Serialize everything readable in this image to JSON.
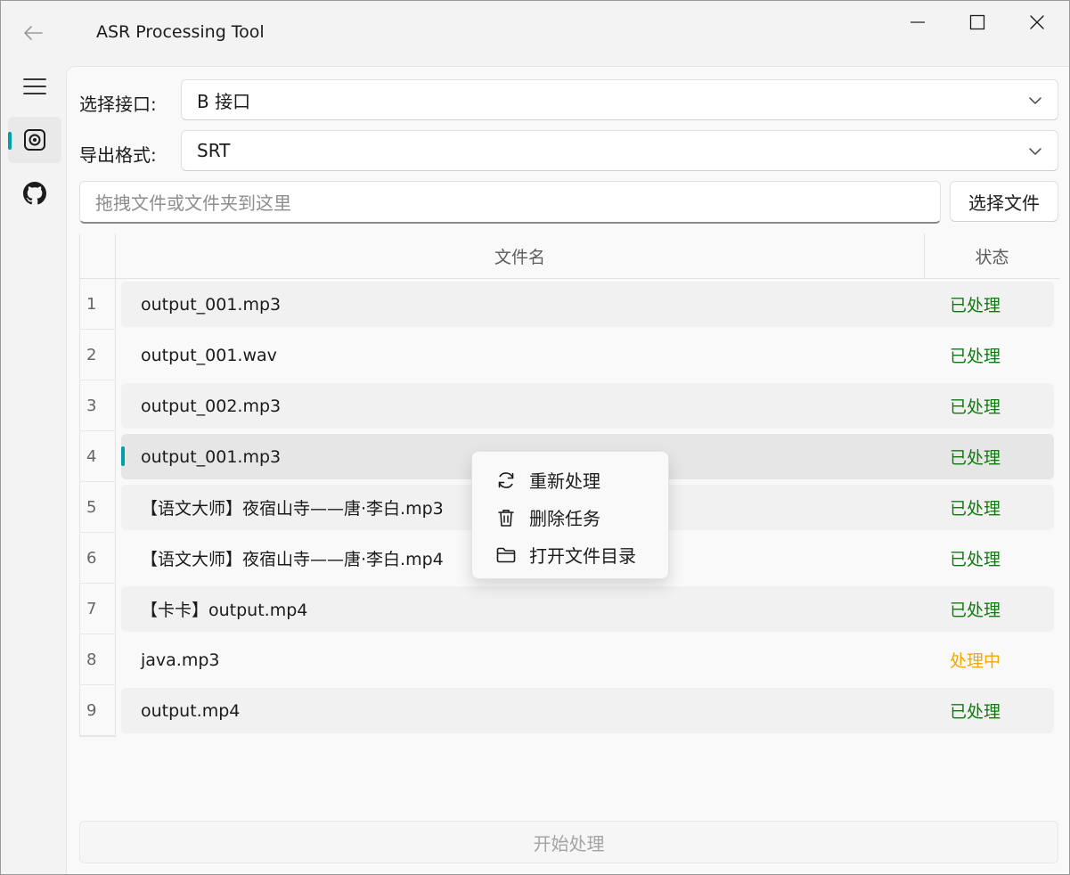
{
  "window": {
    "title": "ASR Processing Tool",
    "accent_color": "#009faa"
  },
  "nav": {
    "items": [
      {
        "icon": "hamburger-menu-icon"
      },
      {
        "icon": "asr-record-icon",
        "selected": true
      },
      {
        "icon": "github-icon"
      }
    ]
  },
  "form": {
    "api_label": "选择接口:",
    "api_value": "B 接口",
    "format_label": "导出格式:",
    "format_value": "SRT",
    "drop_placeholder": "拖拽文件或文件夹到这里",
    "select_file_label": "选择文件"
  },
  "table": {
    "headers": {
      "name": "文件名",
      "status": "状态"
    },
    "rows": [
      {
        "num": "1",
        "name": "output_001.mp3",
        "status": "已处理"
      },
      {
        "num": "2",
        "name": "output_001.wav",
        "status": "已处理"
      },
      {
        "num": "3",
        "name": "output_002.mp3",
        "status": "已处理"
      },
      {
        "num": "4",
        "name": "output_001.mp3",
        "status": "已处理"
      },
      {
        "num": "5",
        "name": "【语文大师】夜宿山寺——唐·李白.mp3",
        "status": "已处理"
      },
      {
        "num": "6",
        "name": "【语文大师】夜宿山寺——唐·李白.mp4",
        "status": "已处理"
      },
      {
        "num": "7",
        "name": "【卡卡】output.mp4",
        "status": "已处理"
      },
      {
        "num": "8",
        "name": "java.mp3",
        "status": "处理中"
      },
      {
        "num": "9",
        "name": "output.mp4",
        "status": "已处理"
      }
    ],
    "status_colors": {
      "done": "#0f7b0f",
      "processing": "#f2a900"
    }
  },
  "context_menu": {
    "items": [
      {
        "icon": "refresh-icon",
        "label": "重新处理"
      },
      {
        "icon": "trash-icon",
        "label": "删除任务"
      },
      {
        "icon": "folder-icon",
        "label": "打开文件目录"
      }
    ]
  },
  "actions": {
    "start_label": "开始处理"
  }
}
